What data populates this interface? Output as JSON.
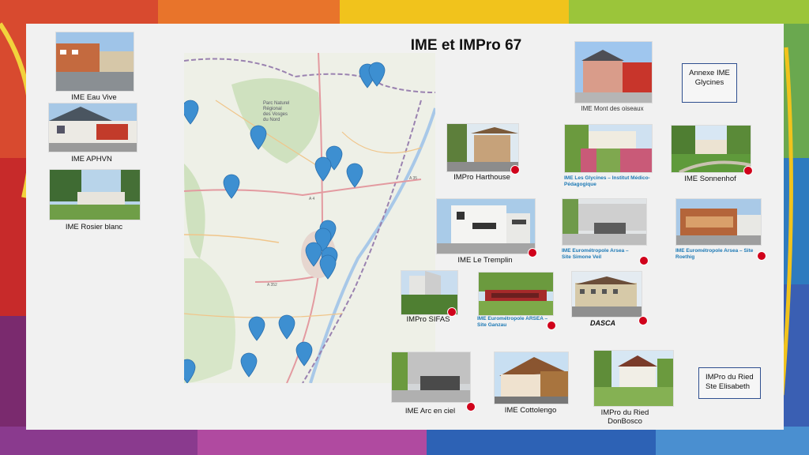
{
  "slide": {
    "title": "IME et IMPro 67",
    "map": {
      "labels": {
        "park": "Parc Naturel Régional des Vosges du Nord",
        "road1": "A 4",
        "road2": "A 35",
        "road3": "A 352"
      }
    },
    "facilities": [
      {
        "key": "eau_vive",
        "label": "IME Eau Vive"
      },
      {
        "key": "aphvn",
        "label": "IME APHVN"
      },
      {
        "key": "rosier",
        "label": "IME Rosier blanc"
      },
      {
        "key": "mont_oiseaux",
        "label": "IME Mont des oiseaux"
      },
      {
        "key": "harthouse",
        "label": "IMPro Harthouse"
      },
      {
        "key": "glycines",
        "label": "IME Les Glycines – Institut Médico-Pédagogique"
      },
      {
        "key": "sonnenhof",
        "label": "IME Sonnenhof"
      },
      {
        "key": "tremplin",
        "label": "IME Le Tremplin"
      },
      {
        "key": "simone_veil",
        "label": "IME Eurométropole Arsea – Site Simone Veil"
      },
      {
        "key": "roethig",
        "label": "IME Eurométropole Arsea – Site Roethig"
      },
      {
        "key": "sifas",
        "label": "IMPro SIFAS"
      },
      {
        "key": "ganzau",
        "label": "IME Eurométropole ARSEA – Site Ganzau"
      },
      {
        "key": "dasca",
        "label": "DASCA"
      },
      {
        "key": "arc_en_ciel",
        "label": "IME Arc en ciel"
      },
      {
        "key": "cottolengo",
        "label": "IME Cottolengo"
      },
      {
        "key": "donbosco",
        "label": "IMPro du Ried DonBosco"
      }
    ],
    "boxes": {
      "annexe": "Annexe IME Glycines",
      "ried": "IMPro du Ried Ste Elisabeth"
    }
  },
  "colors": {
    "pin": "#3d8fd1",
    "dot": "#d0021b",
    "box_border": "#2f4f8f",
    "link_blue": "#1d79b5"
  }
}
